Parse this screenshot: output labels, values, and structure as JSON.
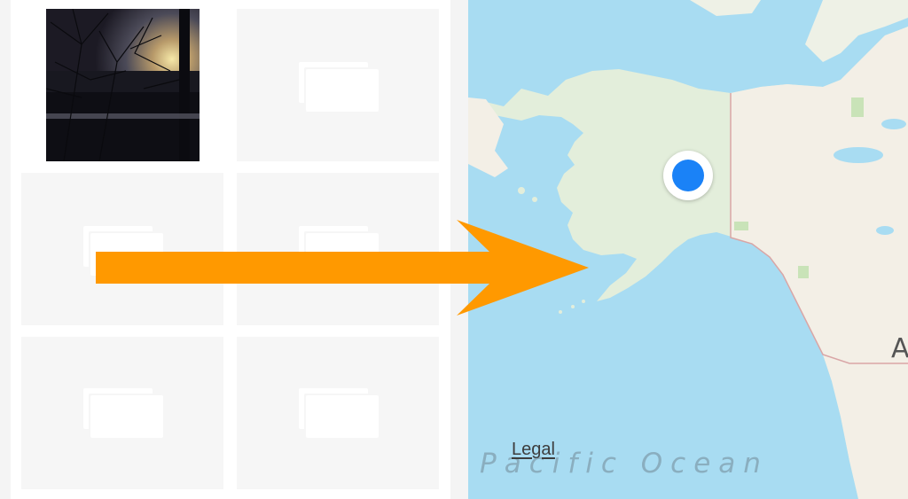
{
  "gallery": {
    "items": [
      {
        "kind": "photo",
        "icon": "sunset-photo"
      },
      {
        "kind": "placeholder",
        "icon": "image-placeholder-icon"
      },
      {
        "kind": "placeholder",
        "icon": "image-placeholder-icon"
      },
      {
        "kind": "placeholder",
        "icon": "image-placeholder-icon"
      },
      {
        "kind": "placeholder",
        "icon": "image-placeholder-icon"
      },
      {
        "kind": "placeholder",
        "icon": "image-placeholder-icon"
      }
    ]
  },
  "map": {
    "legal_label": "Legal",
    "ocean_label": "Pacific Ocean",
    "edge_label": "A",
    "location_pin_color": "#1a82f7",
    "water_color": "#a8dcf2",
    "land_color": "#e3eedb"
  },
  "annotation": {
    "arrow_color": "#ff9900",
    "arrow_icon": "arrow-right-icon"
  }
}
